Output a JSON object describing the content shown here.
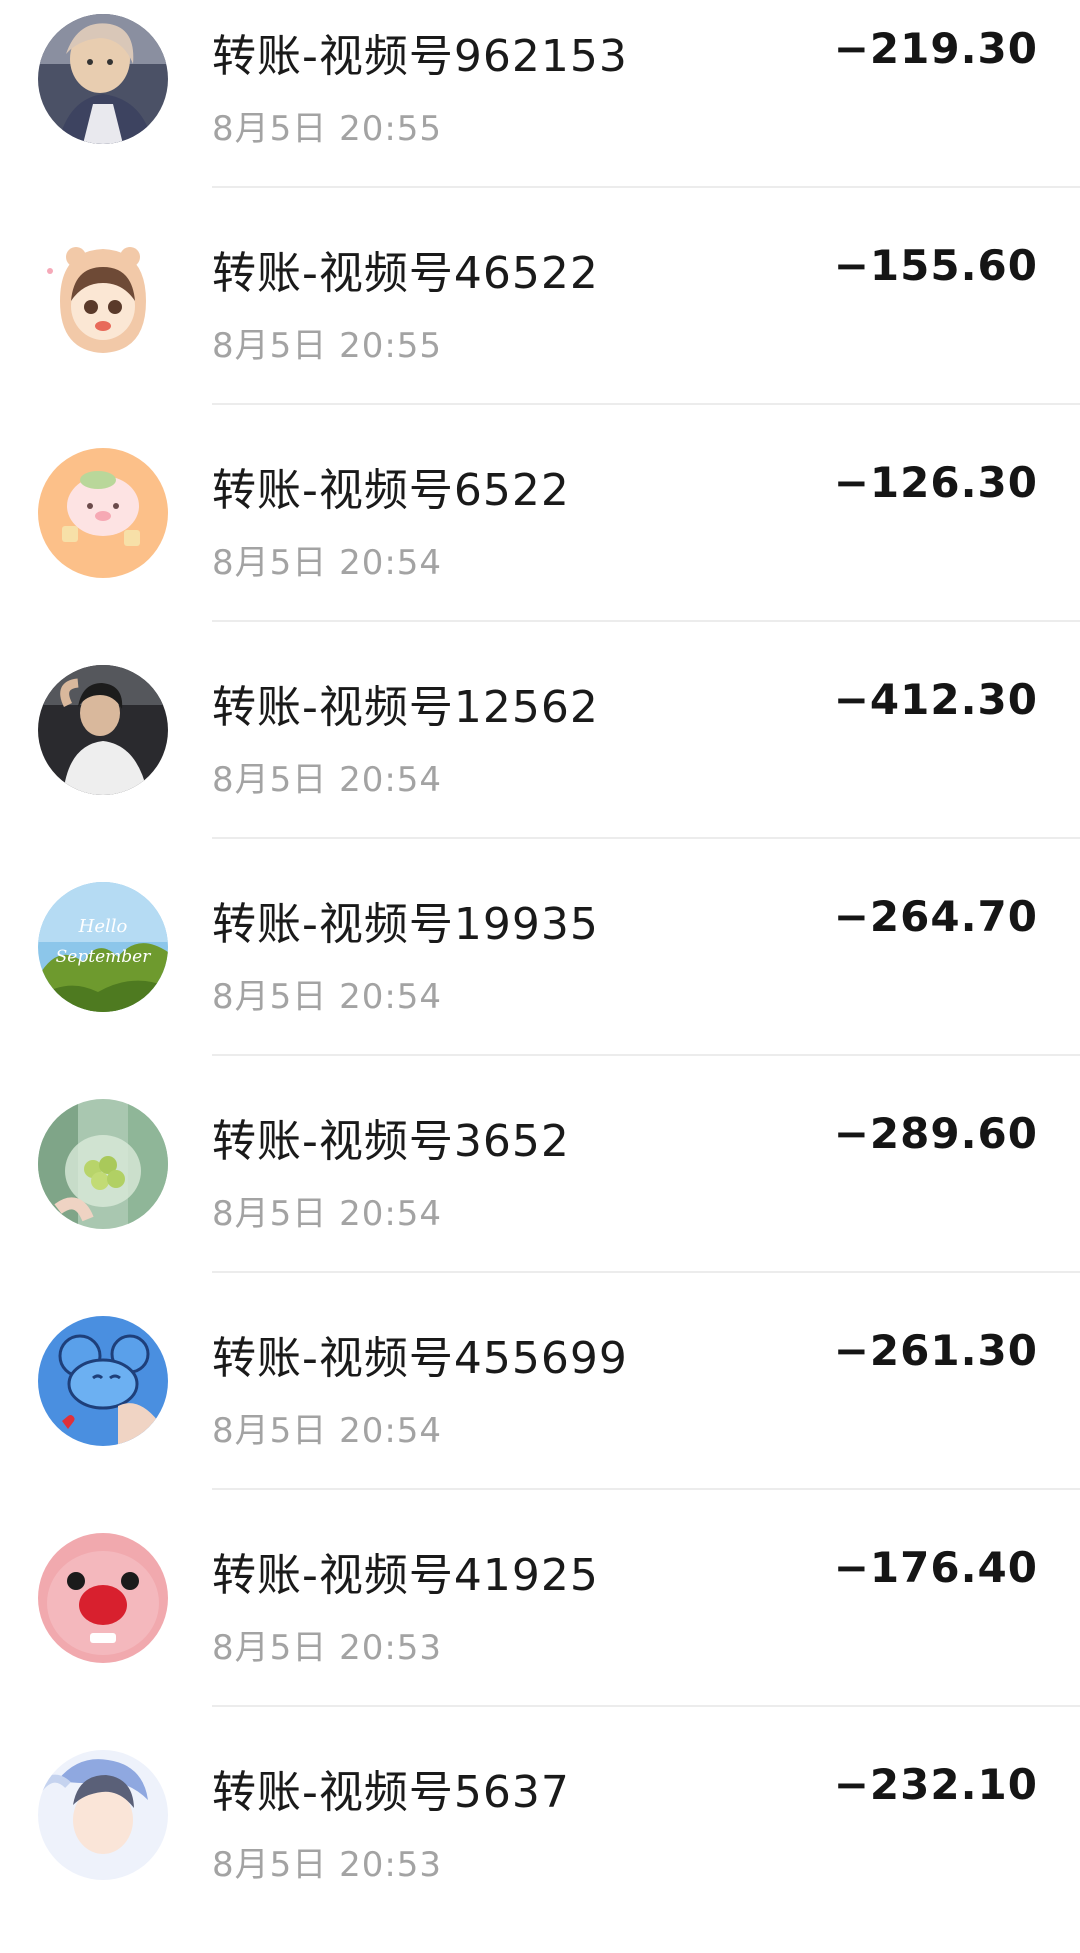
{
  "transactions": [
    {
      "title": "转账-视频号962153",
      "time": "8月5日 20:55",
      "amount": "−219.30",
      "avatar": "photo-girl-jacket"
    },
    {
      "title": "转账-视频号46522",
      "time": "8月5日 20:55",
      "amount": "−155.60",
      "avatar": "cartoon-girl-bear-hood"
    },
    {
      "title": "转账-视频号6522",
      "time": "8月5日 20:54",
      "amount": "−126.30",
      "avatar": "cartoon-pink-pig"
    },
    {
      "title": "转账-视频号12562",
      "time": "8月5日 20:54",
      "amount": "−412.30",
      "avatar": "photo-boy-white-shirt"
    },
    {
      "title": "转账-视频号19935",
      "time": "8月5日 20:54",
      "amount": "−264.70",
      "avatar": "photo-hello-september-trees",
      "avatar_text": [
        "Hello",
        "September"
      ]
    },
    {
      "title": "转账-视频号3652",
      "time": "8月5日 20:54",
      "amount": "−289.60",
      "avatar": "photo-grapes-in-glass"
    },
    {
      "title": "转账-视频号455699",
      "time": "8月5日 20:54",
      "amount": "−261.30",
      "avatar": "cartoon-blue-mouse"
    },
    {
      "title": "转账-视频号41925",
      "time": "8月5日 20:53",
      "amount": "−176.40",
      "avatar": "plush-pink-seal"
    },
    {
      "title": "转账-视频号5637",
      "time": "8月5日 20:53",
      "amount": "−232.10",
      "avatar": "manga-boy"
    }
  ]
}
